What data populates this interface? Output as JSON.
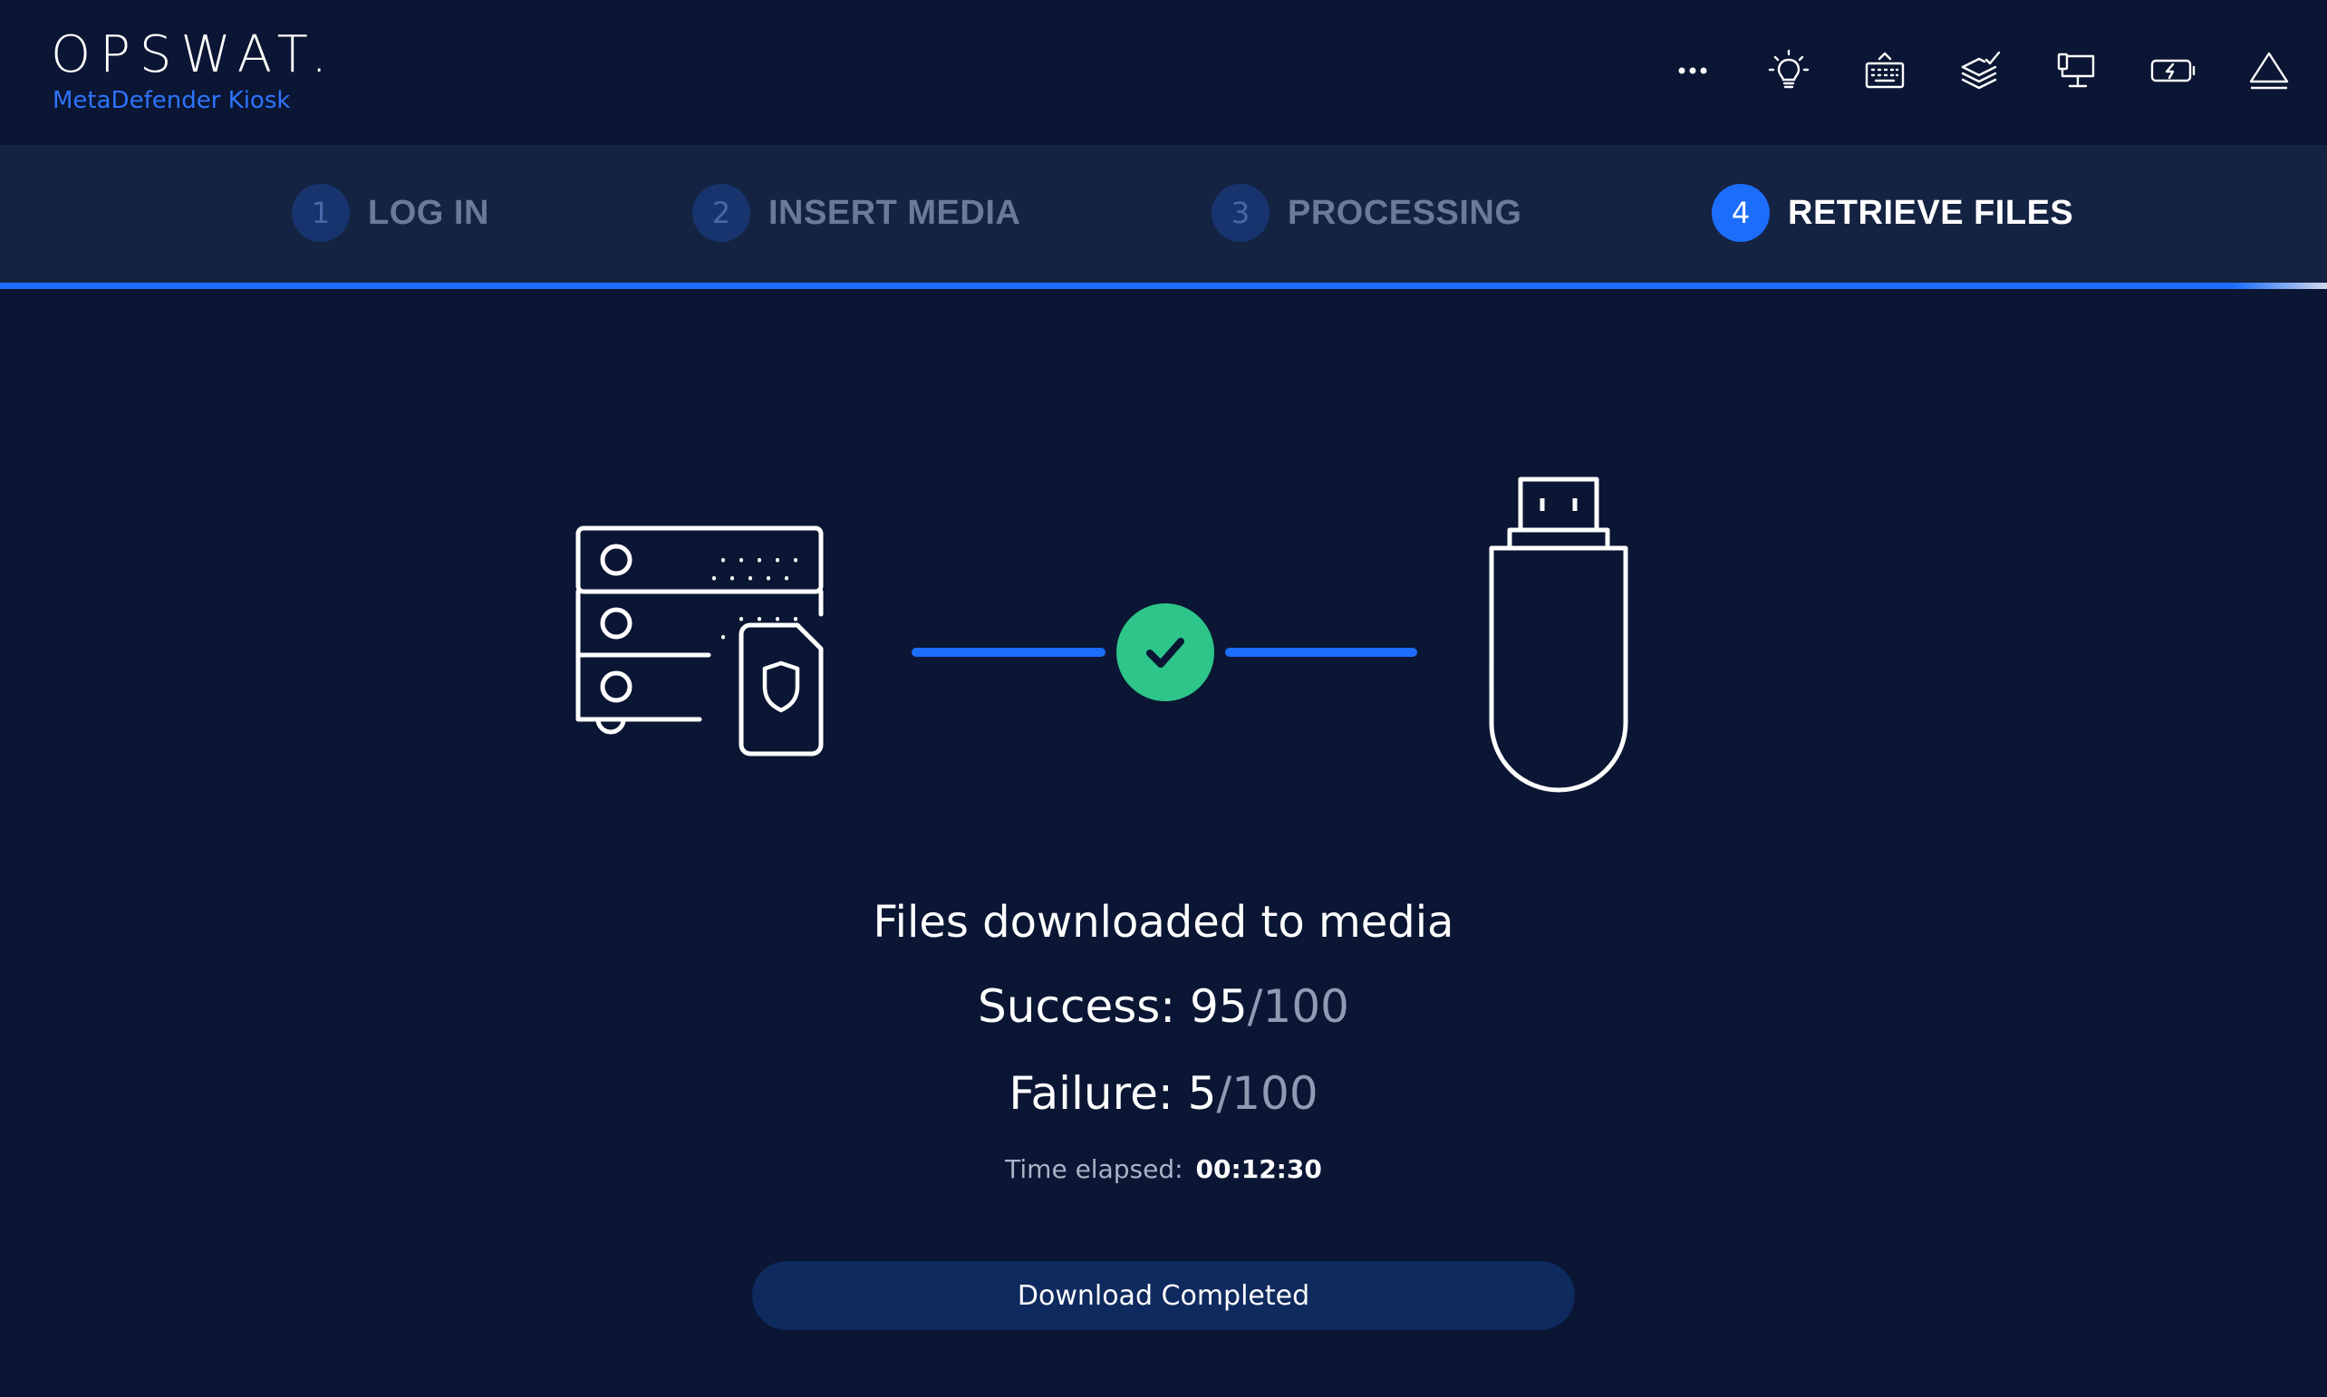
{
  "header": {
    "logo": "OPSWAT.",
    "product": "MetaDefender Kiosk",
    "toolbar": [
      {
        "icon": "more-icon"
      },
      {
        "icon": "lightbulb-icon"
      },
      {
        "icon": "keyboard-icon"
      },
      {
        "icon": "layers-check-icon"
      },
      {
        "icon": "workstation-icon"
      },
      {
        "icon": "battery-charging-icon"
      },
      {
        "icon": "eject-icon"
      }
    ]
  },
  "stepper": {
    "progress_percent": 100,
    "steps": [
      {
        "num": "1",
        "label": "LOG IN",
        "state": "completed"
      },
      {
        "num": "2",
        "label": "INSERT MEDIA",
        "state": "completed"
      },
      {
        "num": "3",
        "label": "PROCESSING",
        "state": "completed"
      },
      {
        "num": "4",
        "label": "RETRIEVE FILES",
        "state": "active"
      }
    ]
  },
  "illustration": {
    "source": "server-shield-icon",
    "status": "check-icon",
    "target": "usb-drive-icon",
    "status_color": "#2ec58a",
    "line_color": "#1d6dfb"
  },
  "result": {
    "title": "Files downloaded to media",
    "success_label": "Success: ",
    "success_count": "95",
    "success_total": "/100",
    "failure_label": "Failure: ",
    "failure_count": "5",
    "failure_total": "/100",
    "elapsed_label": "Time elapsed:",
    "elapsed_value": "00:12:30"
  },
  "actions": {
    "download_label": "Download Completed"
  },
  "colors": {
    "background": "#0a1633",
    "stepper_bg": "#152342",
    "accent": "#1d6dfb",
    "brand_blue": "#2e74ff",
    "success": "#2ec58a"
  }
}
